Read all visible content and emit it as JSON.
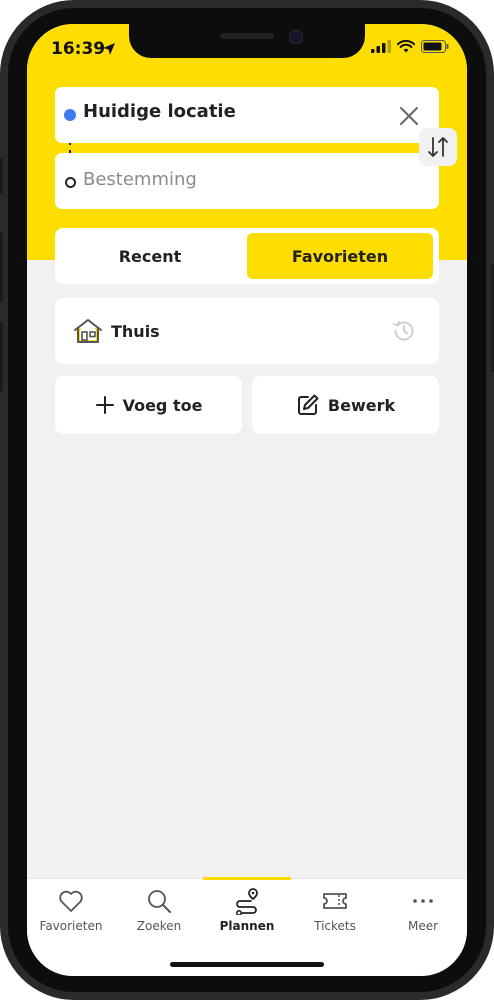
{
  "status": {
    "time": "16:39"
  },
  "route": {
    "origin_label": "Huidige locatie",
    "destination_placeholder": "Bestemming"
  },
  "segments": {
    "recent": "Recent",
    "favorites": "Favorieten",
    "active": "favorites"
  },
  "favorites": [
    {
      "label": "Thuis",
      "icon": "house-icon"
    }
  ],
  "actions": {
    "add": "Voeg toe",
    "edit": "Bewerk"
  },
  "tabs": [
    {
      "label": "Favorieten",
      "icon": "heart-icon"
    },
    {
      "label": "Zoeken",
      "icon": "search-icon"
    },
    {
      "label": "Plannen",
      "icon": "route-icon",
      "active": true
    },
    {
      "label": "Tickets",
      "icon": "ticket-icon"
    },
    {
      "label": "Meer",
      "icon": "more-icon"
    }
  ],
  "colors": {
    "accent": "#fede00",
    "origin_dot": "#3d7cf0",
    "background": "#f1f1f1"
  }
}
